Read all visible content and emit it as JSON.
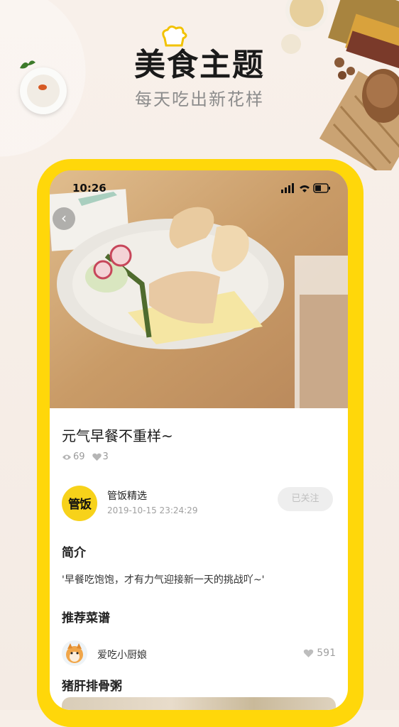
{
  "promo": {
    "title": "美食主题",
    "subtitle": "每天吃出新花样"
  },
  "status_bar": {
    "time": "10:26"
  },
  "post": {
    "title": "元气早餐不重样~",
    "views": "69",
    "likes": "3"
  },
  "author": {
    "avatar_text": "管饭",
    "name": "管饭精选",
    "time": "2019-10-15 23:24:29",
    "follow_label": "已关注"
  },
  "intro": {
    "heading": "简介",
    "text": "'早餐吃饱饱，才有力气迎接新一天的挑战吖~'"
  },
  "recommend": {
    "heading": "推荐菜谱",
    "user": "爱吃小厨娘",
    "likes": "591",
    "recipe_title": "猪肝排骨粥"
  },
  "colors": {
    "frame": "#ffd70a",
    "background": "#f7efe8"
  }
}
